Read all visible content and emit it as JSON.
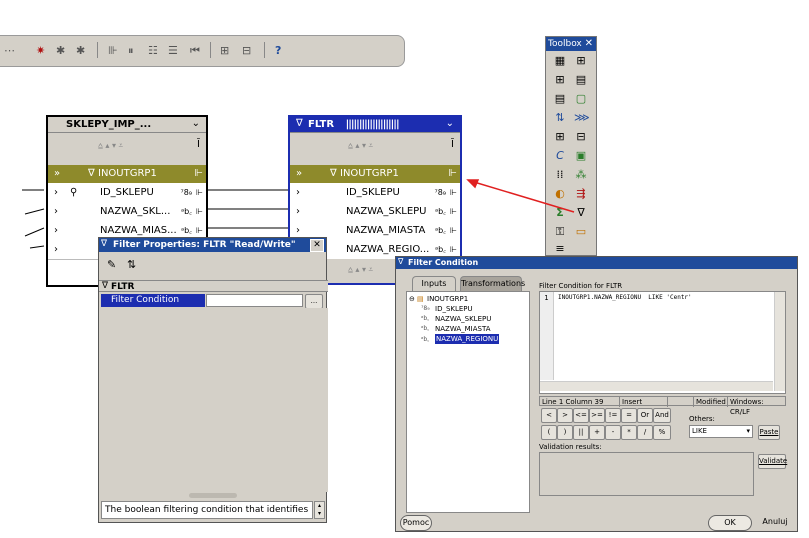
{
  "toolbox": {
    "title": "Toolbox",
    "close": "✕",
    "icons": [
      "source-icon",
      "target-icon",
      "expression-icon",
      "aggregator-icon",
      "document-icon",
      "sequence-icon",
      "splitter-icon",
      "joiner-icon",
      "lookup-icon",
      "lookup-table-icon",
      "cycle-icon",
      "table-icon",
      "matching-icon",
      "mapping-icon",
      "deduplicator-icon",
      "merge-icon",
      "constant-icon",
      "filter-icon",
      "key-icon",
      "transform-icon"
    ]
  },
  "sklepy": {
    "title": "SKLEPY_IMP_...",
    "group": "INOUTGRP1",
    "rows": [
      {
        "label": "ID_SKLEPU",
        "type": "⁷8₉"
      },
      {
        "label": "NAZWA_SKL...",
        "type": "ᵃb꜀"
      },
      {
        "label": "NAZWA_MIAS...",
        "type": "ᵃb꜀"
      },
      {
        "label": "",
        "type": ""
      }
    ]
  },
  "fltr": {
    "title": "FLTR",
    "group": "INOUTGRP1",
    "rows": [
      {
        "label": "ID_SKLEPU",
        "type": "⁷8₉"
      },
      {
        "label": "NAZWA_SKLEPU",
        "type": "ᵃb꜀"
      },
      {
        "label": "NAZWA_MIASTA",
        "type": "ᵃb꜀"
      },
      {
        "label": "NAZWA_REGIO...",
        "type": "ᵃb꜀"
      }
    ]
  },
  "filter_properties": {
    "title": "Filter Properties: FLTR \"Read/Write\"",
    "close": "✕",
    "section": "FLTR",
    "property_label": "Filter Condition",
    "property_value": "",
    "ellipsis": "...",
    "description": "The boolean filtering condition that identifies"
  },
  "filter_condition": {
    "title": "Filter Condition",
    "tabs": [
      "Inputs",
      "Transformations"
    ],
    "tree_root": "INOUTGRP1",
    "tree_items": [
      "ID_SKLEPU",
      "NAZWA_SKLEPU",
      "NAZWA_MIASTA",
      "NAZWA_REGIONU"
    ],
    "editor_label": "Filter Condition for FLTR",
    "line_number": "1",
    "code": "INOUTGRP1.NAZWA_REGIONU  LIKE 'Centr'",
    "status": [
      "Line 1 Column 39",
      "Insert",
      "",
      "Modified",
      "Windows: CR/LF"
    ],
    "operator_row1": [
      "<",
      ">",
      "<=",
      ">=",
      "!=",
      "=",
      "Or",
      "And"
    ],
    "operator_row2": [
      "(",
      ")",
      "||",
      "+",
      "-",
      "*",
      "/",
      "%"
    ],
    "others_label": "Others:",
    "others_value": "LIKE",
    "paste": "Paste",
    "validation_label": "Validation results:",
    "validate": "Validate",
    "help": "Pomoc",
    "ok": "OK",
    "cancel": "Anuluj"
  },
  "colors": {
    "title_bar": "#1f4b9b",
    "group_row": "#8e8a2b",
    "selection": "#0a24d6",
    "connector_arrow": "#e02020"
  }
}
